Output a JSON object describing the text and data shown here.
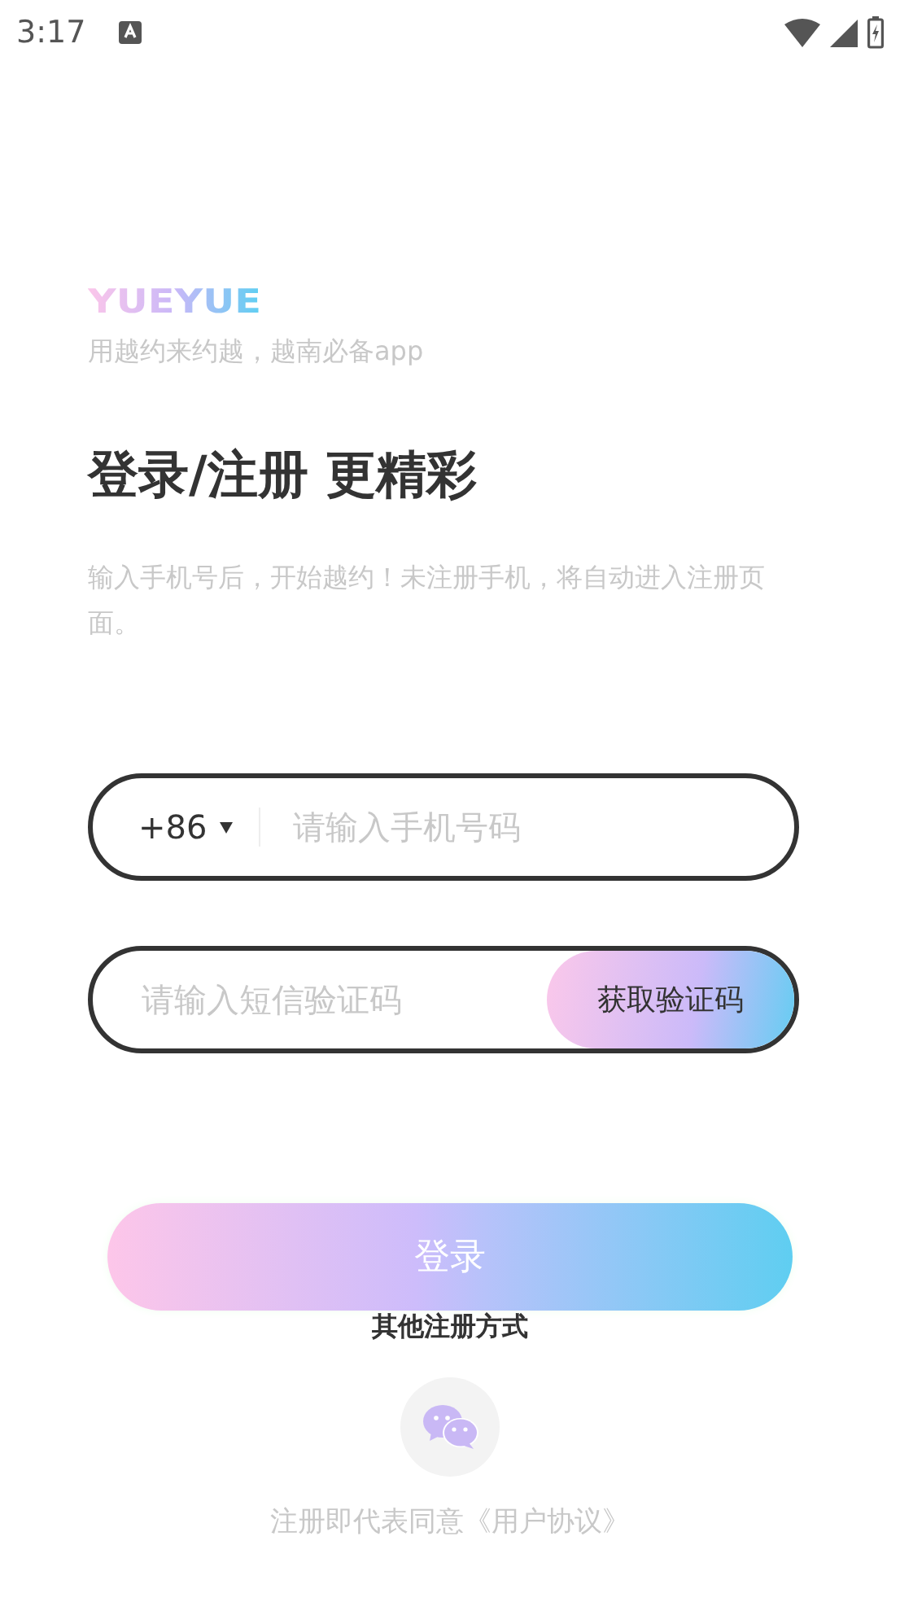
{
  "status_bar": {
    "time": "3:17"
  },
  "brand": {
    "logo": "YUEYUE",
    "tagline": "用越约来约越，越南必备app"
  },
  "heading": "登录/注册 更精彩",
  "intro": "输入手机号后，开始越约！未注册手机，将自动进入注册页面。",
  "phone_field": {
    "country_code": "+86",
    "placeholder": "请输入手机号码"
  },
  "code_field": {
    "placeholder": "请输入短信验证码",
    "button": "获取验证码"
  },
  "login_button": "登录",
  "other_methods": "其他注册方式",
  "agreement": "注册即代表同意《用户协议》"
}
